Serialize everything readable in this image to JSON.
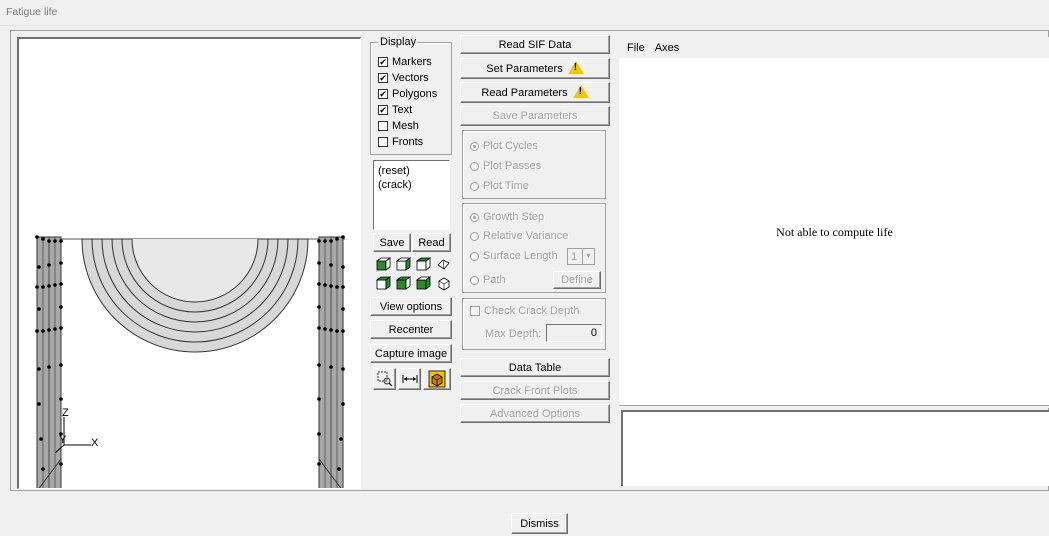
{
  "window": {
    "title": "Fatigue life"
  },
  "display": {
    "group_label": "Display",
    "checkboxes": [
      {
        "label": "Markers",
        "checked": true
      },
      {
        "label": "Vectors",
        "checked": true
      },
      {
        "label": "Polygons",
        "checked": true
      },
      {
        "label": "Text",
        "checked": true
      },
      {
        "label": "Mesh",
        "checked": false
      },
      {
        "label": "Fronts",
        "checked": false
      }
    ],
    "view_list": [
      "(reset)",
      "(crack)"
    ],
    "save_label": "Save",
    "read_label": "Read",
    "view_options_label": "View options",
    "recenter_label": "Recenter",
    "capture_label": "Capture image"
  },
  "viewport": {
    "axis_z": "Z",
    "axis_y": "Y",
    "axis_x": "X"
  },
  "controls": {
    "read_sif": "Read SIF Data",
    "set_params": "Set Parameters",
    "read_params": "Read Parameters",
    "save_params": "Save Parameters",
    "plot_mode": [
      "Plot Cycles",
      "Plot Passes",
      "Plot Time"
    ],
    "growth_mode": [
      "Growth Step",
      "Relative Variance",
      "Surface Length",
      "Path"
    ],
    "surface_length_value": "1",
    "define_label": "Define",
    "check_depth_label": "Check Crack Depth",
    "max_depth_label": "Max Depth:",
    "max_depth_value": "0",
    "data_table": "Data Table",
    "crack_front_plots": "Crack Front Plots",
    "advanced_options": "Advanced Options"
  },
  "plot": {
    "menu": [
      "File",
      "Axes"
    ],
    "message": "Not able to compute life"
  },
  "footer": {
    "dismiss": "Dismiss"
  },
  "colors": {
    "accent_warning": "#f4c400",
    "mesh_fill": "#d8d8d8"
  }
}
